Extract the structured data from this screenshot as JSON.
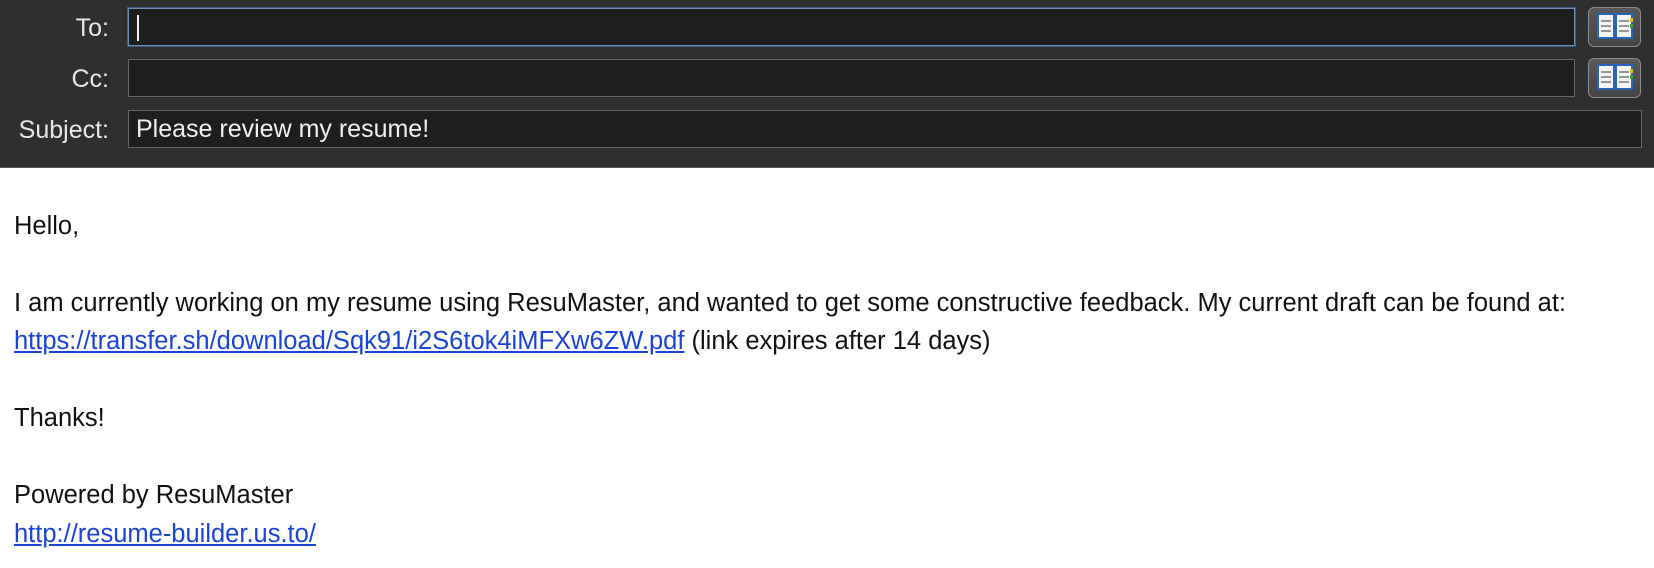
{
  "header": {
    "to_label": "To:",
    "to_value": "",
    "cc_label": "Cc:",
    "cc_value": "",
    "subject_label": "Subject:",
    "subject_value": "Please review my resume!",
    "address_book_icon": "address-book-icon"
  },
  "message": {
    "greeting": "Hello,",
    "line1_text": "I am currently working on my resume using ResuMaster, and wanted to get some constructive feedback. My current draft can be found at: ",
    "line1_link": "https://transfer.sh/download/Sqk91/i2S6tok4iMFXw6ZW.pdf",
    "line1_suffix": " (link expires after 14 days)",
    "thanks": "Thanks!",
    "signature_text": "Powered by ResuMaster",
    "signature_link": "http://resume-builder.us.to/"
  },
  "colors": {
    "header_bg": "#2f2f2f",
    "field_bg": "#1e1e1e",
    "link": "#1a44d8"
  }
}
